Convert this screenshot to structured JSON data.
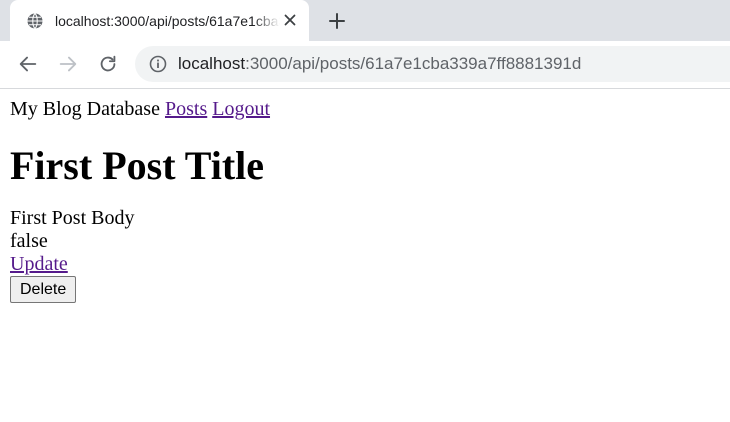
{
  "browser": {
    "tab": {
      "title": "localhost:3000/api/posts/61a7e1cba339a7ff8881391d",
      "favicon": "globe-icon",
      "close_icon": "close-icon"
    },
    "new_tab_icon": "plus-icon",
    "nav": {
      "back_icon": "arrow-left-icon",
      "forward_icon": "arrow-right-icon",
      "reload_icon": "reload-icon"
    },
    "address_bar": {
      "info_icon": "info-icon",
      "host": "localhost",
      "path": ":3000/api/posts/61a7e1cba339a7ff8881391d"
    },
    "colors": {
      "tabstrip": "#dee1e6",
      "omnibox": "#f1f3f4",
      "visited_link": "#551a8b"
    }
  },
  "page": {
    "brand": "My Blog Database",
    "nav_links": {
      "posts": "Posts",
      "logout": "Logout"
    },
    "post": {
      "title": "First Post Title",
      "body": "First Post Body",
      "status": "false"
    },
    "actions": {
      "update": "Update",
      "delete": "Delete"
    }
  }
}
